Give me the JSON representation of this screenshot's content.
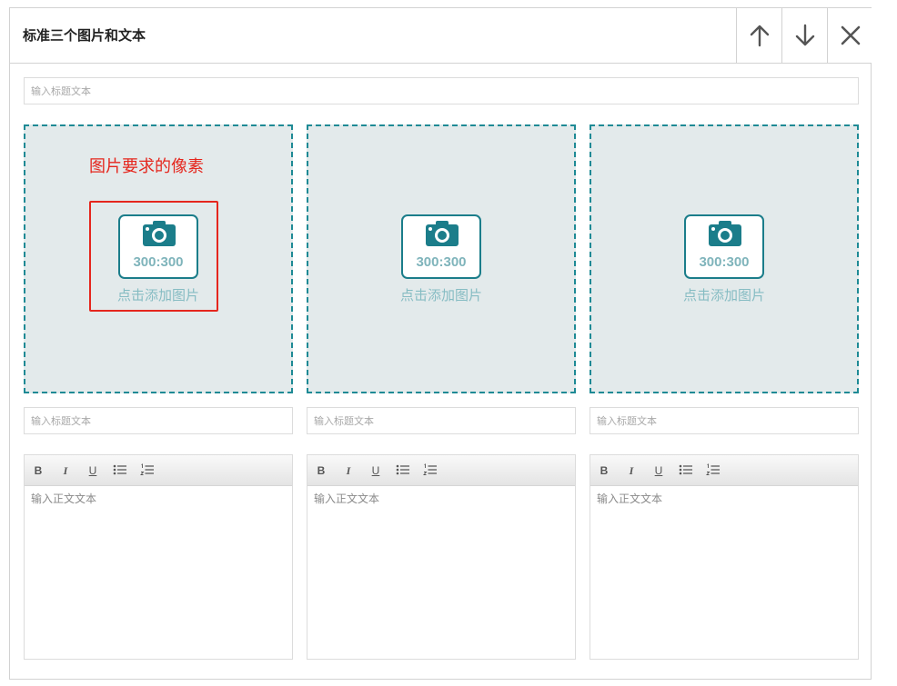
{
  "header": {
    "title": "标准三个图片和文本"
  },
  "buttons": {
    "up": "move-up",
    "down": "move-down",
    "close": "close"
  },
  "main_title_placeholder": "输入标题文本",
  "annotation": {
    "text": "图片要求的像素"
  },
  "columns": [
    {
      "image": {
        "ratio": "300:300",
        "add_label": "点击添加图片"
      },
      "title_placeholder": "输入标题文本",
      "body_placeholder": "输入正文文本"
    },
    {
      "image": {
        "ratio": "300:300",
        "add_label": "点击添加图片"
      },
      "title_placeholder": "输入标题文本",
      "body_placeholder": "输入正文文本"
    },
    {
      "image": {
        "ratio": "300:300",
        "add_label": "点击添加图片"
      },
      "title_placeholder": "输入标题文本",
      "body_placeholder": "输入正文文本"
    }
  ],
  "toolbar": {
    "bold": "B",
    "italic": "I",
    "underline": "U"
  },
  "colors": {
    "accent": "#1b7d8a",
    "annotation": "#e5261d",
    "slot_bg": "#e3eaeb"
  }
}
